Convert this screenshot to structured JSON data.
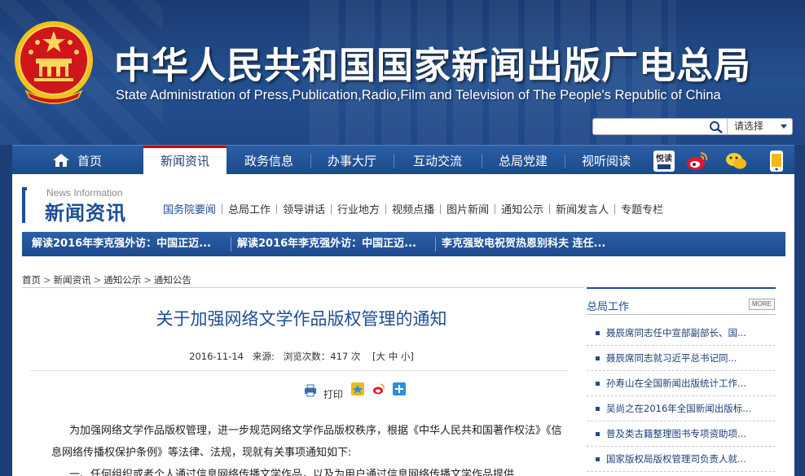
{
  "header": {
    "title_cn": "中华人民共和国国家新闻出版广电总局",
    "title_en": "State Administration of Press,Publication,Radio,Film and Television of The People's Republic of China"
  },
  "search": {
    "placeholder": "",
    "select_label": "请选择"
  },
  "main_nav": {
    "items": [
      {
        "label": "首页"
      },
      {
        "label": "新闻资讯"
      },
      {
        "label": "政务信息"
      },
      {
        "label": "办事大厅"
      },
      {
        "label": "互动交流"
      },
      {
        "label": "总局党建"
      },
      {
        "label": "视听阅读"
      }
    ],
    "active": "新闻资讯",
    "icons": [
      "yuedu-icon",
      "weibo-icon",
      "weixin-icon",
      "mobile-icon"
    ],
    "icon_text": "悦读"
  },
  "section": {
    "title_en": "News Information",
    "title_cn": "新闻资讯",
    "subnav": [
      {
        "label": "国务院要闻"
      },
      {
        "label": "总局工作"
      },
      {
        "label": "领导讲话"
      },
      {
        "label": "行业地方"
      },
      {
        "label": "视频点播"
      },
      {
        "label": "图片新闻"
      },
      {
        "label": "通知公示"
      },
      {
        "label": "新闻发言人"
      },
      {
        "label": "专题专栏"
      }
    ],
    "active_sub": "国务院要闻"
  },
  "ticker": [
    {
      "label": "解读2016年李克强外访：中国正迈..."
    },
    {
      "label": "解读2016年李克强外访：中国正迈..."
    },
    {
      "label": "李克强致电祝贺热恩别科夫 连任..."
    }
  ],
  "breadcrumb": [
    "首页",
    "新闻资讯",
    "通知公示",
    "通知公告"
  ],
  "article": {
    "title": "关于加强网络文学作品版权管理的通知",
    "date": "2016-11-14",
    "source_label": "来源:",
    "views_label": "浏览次数：417 次",
    "size_open": "[",
    "size_large": "大",
    "size_medium": "中",
    "size_small": "小",
    "size_close": "]",
    "print_label": "打印",
    "paragraphs": [
      "为加强网络文学作品版权管理，进一步规范网络文学作品版权秩序，根据《中华人民共和国著作权法》《信息网络传播权保护条例》等法律、法规，现就有关事项通知如下:",
      "一、任何组织或者个人通过信息网络传播文学作品，以及为用户通过信息网络传播文学作品提供"
    ]
  },
  "sidebar": {
    "title": "总局工作",
    "more_label": "MORE",
    "items": [
      {
        "label": "聂辰席同志任中宣部副部长、国..."
      },
      {
        "label": "聂辰席同志就习近平总书记同..."
      },
      {
        "label": "孙寿山在全国新闻出版统计工作..."
      },
      {
        "label": "吴尚之在2016年全国新闻出版标..."
      },
      {
        "label": "普及类古籍整理图书专项资助项..."
      },
      {
        "label": "国家版权局版权管理司负责人就..."
      }
    ]
  },
  "colors": {
    "brand_blue": "#1d4d96",
    "accent_red": "#cc0000"
  }
}
